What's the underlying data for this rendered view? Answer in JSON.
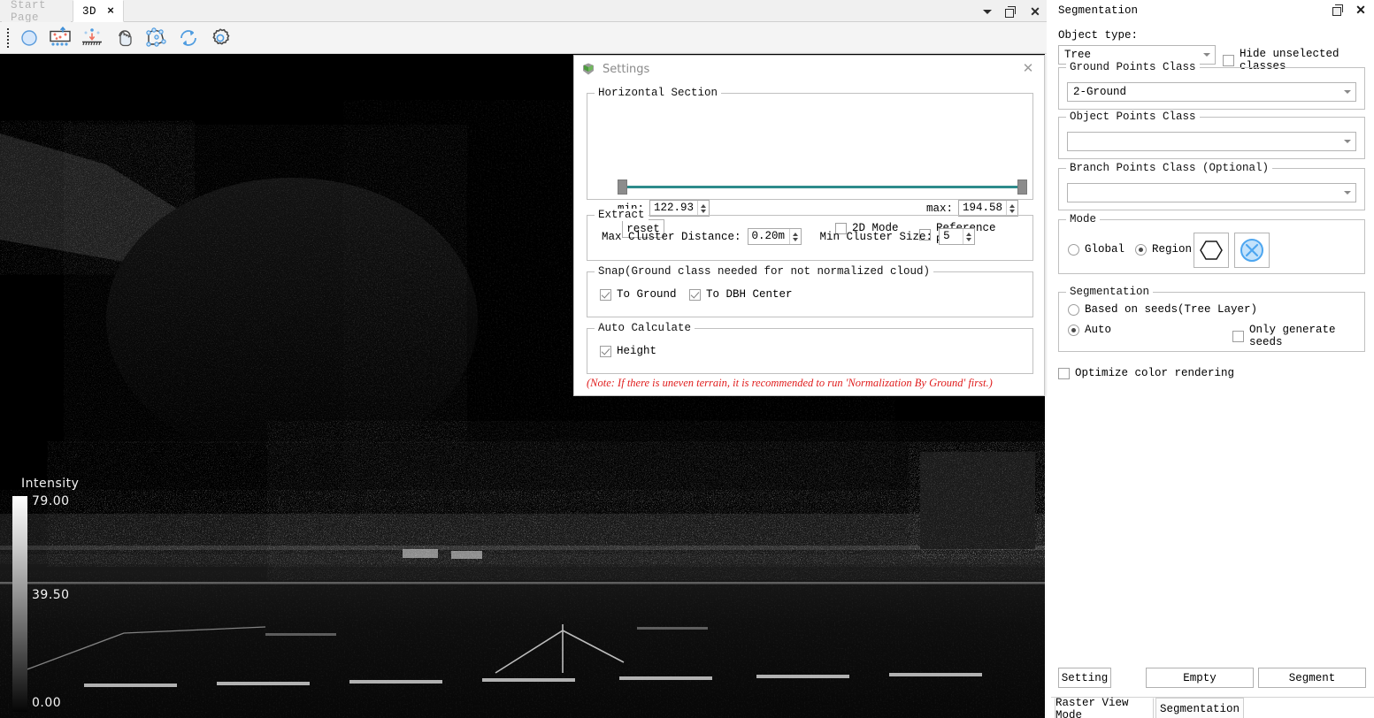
{
  "window": {
    "tabs": [
      {
        "label": "Start Page",
        "active": false,
        "closable": false
      },
      {
        "label": "3D",
        "active": true,
        "closable": true
      }
    ],
    "close_label": "×",
    "controls": [
      {
        "name": "minimize-chevron",
        "glyph": "▾"
      },
      {
        "name": "restore",
        "glyph": "❐"
      },
      {
        "name": "close",
        "glyph": "✕"
      }
    ]
  },
  "toolbar": {
    "buttons": [
      {
        "name": "select-circle-icon",
        "tip": "Circle Select"
      },
      {
        "name": "point-cloud-extract-icon",
        "tip": "Extract Points"
      },
      {
        "name": "project-to-ground-icon",
        "tip": "Project To Ground"
      },
      {
        "name": "pan-hand-icon",
        "tip": "Pan"
      },
      {
        "name": "polygon-select-icon",
        "tip": "Polygon Select"
      },
      {
        "name": "refresh-icon",
        "tip": "Refresh"
      },
      {
        "name": "gear-icon",
        "tip": "Settings"
      }
    ]
  },
  "viewport": {
    "legend": {
      "title": "Intensity",
      "max": "79.00",
      "mid": "39.50",
      "min": "0.00"
    }
  },
  "settings_dialog": {
    "title": "Settings",
    "close_label": "✕",
    "horizontal_section": {
      "title": "Horizontal Section",
      "min_label": "min:",
      "min_value": "122.93",
      "max_label": "max:",
      "max_value": "194.58",
      "reset_label": "reset",
      "two_d_mode": {
        "label": "2D Mode",
        "checked": false
      },
      "reference_plane": {
        "label": "Reference Plane",
        "checked": false
      },
      "slider": {
        "min_pos_pct": 0,
        "max_pos_pct": 100,
        "track_color": "#2d8b8b"
      }
    },
    "extract": {
      "title": "Extract",
      "max_cluster_distance_label": "Max Cluster Distance:",
      "max_cluster_distance_value": "0.20m",
      "min_cluster_size_label": "Min Cluster Size:",
      "min_cluster_size_value": "5"
    },
    "snap": {
      "title": "Snap(Ground class needed for not normalized cloud)",
      "to_ground": {
        "label": "To Ground",
        "checked": true
      },
      "to_dbh_center": {
        "label": "To DBH Center",
        "checked": true
      }
    },
    "auto_calculate": {
      "title": "Auto Calculate",
      "height": {
        "label": "Height",
        "checked": true
      }
    },
    "note": "(Note: If there is uneven terrain, it is recommended to run 'Normalization By Ground' first.)",
    "note_color": "#e01d1d"
  },
  "segmentation_panel": {
    "title": "Segmentation",
    "controls": [
      {
        "name": "restore",
        "glyph": "❐"
      },
      {
        "name": "close",
        "glyph": "✕"
      }
    ],
    "object_type": {
      "label": "Object type:",
      "value": "Tree",
      "options": [
        "Tree"
      ]
    },
    "hide_unselected_classes": {
      "label": "Hide unselected classes",
      "checked": false
    },
    "ground_points_class": {
      "title": "Ground Points Class",
      "value": "2-Ground"
    },
    "object_points_class": {
      "title": "Object Points Class",
      "value": ""
    },
    "branch_points_class": {
      "title": "Branch Points Class (Optional)",
      "value": ""
    },
    "mode": {
      "title": "Mode",
      "global": {
        "label": "Global",
        "checked": false
      },
      "region": {
        "label": "Region",
        "checked": true
      },
      "hex_button": {
        "name": "hexagon-region-icon"
      },
      "clear_button": {
        "name": "clear-region-x-icon",
        "accent": "#4da6f0"
      }
    },
    "segmentation": {
      "title": "Segmentation",
      "based_on_seeds": {
        "label": "Based on seeds(Tree Layer)",
        "checked": false
      },
      "auto": {
        "label": "Auto",
        "checked": true
      },
      "only_generate_seeds": {
        "label": "Only generate seeds",
        "checked": false
      }
    },
    "optimize_color_rendering": {
      "label": "Optimize color rendering",
      "checked": false
    },
    "buttons": {
      "setting": "Setting",
      "empty": "Empty",
      "segment": "Segment"
    },
    "tabs": [
      {
        "label": "Raster View Mode",
        "active": true
      },
      {
        "label": "Segmentation",
        "active": false
      }
    ]
  }
}
